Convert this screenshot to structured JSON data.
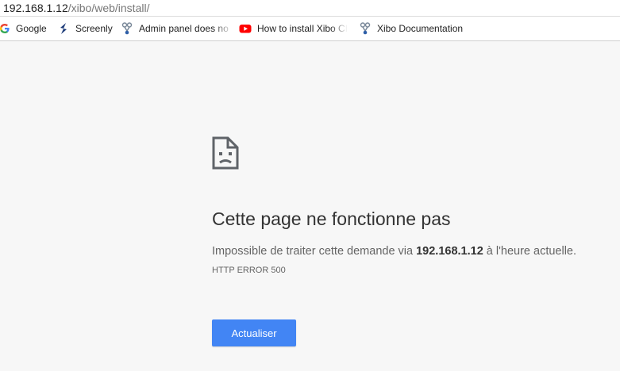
{
  "address_bar": {
    "url_host": "192.168.1.12",
    "url_path": "/xibo/web/install/"
  },
  "bookmarks": [
    {
      "label": "Google",
      "icon": "google-icon"
    },
    {
      "label": "Screenly",
      "icon": "screenly-icon"
    },
    {
      "label": "Admin panel does no",
      "icon": "xibo-icon"
    },
    {
      "label": "How to install Xibo CI",
      "icon": "youtube-icon"
    },
    {
      "label": "Xibo Documentation",
      "icon": "xibo-icon"
    }
  ],
  "error_page": {
    "icon": "sad-page-icon",
    "heading": "Cette page ne fonctionne pas",
    "message_before": "Impossible de traiter cette demande via ",
    "message_host": "192.168.1.12",
    "message_after": " à l'heure actuelle.",
    "error_code": "HTTP ERROR 500",
    "reload_label": "Actualiser"
  },
  "colors": {
    "button": "#4285f4",
    "page_background": "#f7f7f7",
    "youtube_red": "#ff0000"
  }
}
